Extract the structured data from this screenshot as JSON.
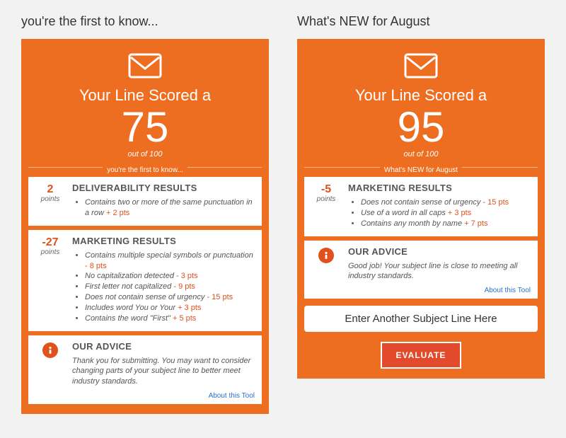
{
  "left": {
    "title": "you're the first to know...",
    "scored_label": "Your Line Scored a",
    "score": "75",
    "outof": "out of 100",
    "subject_echo": "you're the first to know...",
    "sections": [
      {
        "points": "2",
        "points_label": "points",
        "title": "DELIVERABILITY RESULTS",
        "items": [
          {
            "text": "Contains two or more of the same punctuation in a row",
            "delta": "+ 2 pts"
          }
        ]
      },
      {
        "points": "-27",
        "points_label": "points",
        "title": "MARKETING RESULTS",
        "items": [
          {
            "text": "Contains multiple special symbols or punctuation",
            "delta": "- 8 pts"
          },
          {
            "text": "No capitalization detected",
            "delta": "- 3 pts"
          },
          {
            "text": "First letter not capitalized",
            "delta": "- 9 pts"
          },
          {
            "text": "Does not contain sense of urgency",
            "delta": "- 15 pts"
          },
          {
            "text": "Includes word You or Your",
            "delta": "+ 3 pts"
          },
          {
            "text": "Contains the word \"First\"",
            "delta": "+ 5 pts"
          }
        ]
      }
    ],
    "advice_title": "OUR ADVICE",
    "advice_text": "Thank you for submitting. You may want to consider changing parts of your subject line to better meet industry standards.",
    "about_link": "About this Tool"
  },
  "right": {
    "title": "What's NEW for August",
    "scored_label": "Your Line Scored a",
    "score": "95",
    "outof": "out of 100",
    "subject_echo": "What's NEW for August",
    "sections": [
      {
        "points": "-5",
        "points_label": "points",
        "title": "MARKETING RESULTS",
        "items": [
          {
            "text": "Does not contain sense of urgency",
            "delta": "- 15 pts"
          },
          {
            "text": "Use of a word in all caps",
            "delta": "+ 3 pts"
          },
          {
            "text": "Contains any month by name",
            "delta": "+ 7 pts"
          }
        ]
      }
    ],
    "advice_title": "OUR ADVICE",
    "advice_text": "Good job! Your subject line is close to meeting all industry standards.",
    "about_link": "About this Tool",
    "input_placeholder": "Enter Another Subject Line Here",
    "evaluate_label": "EVALUATE"
  }
}
